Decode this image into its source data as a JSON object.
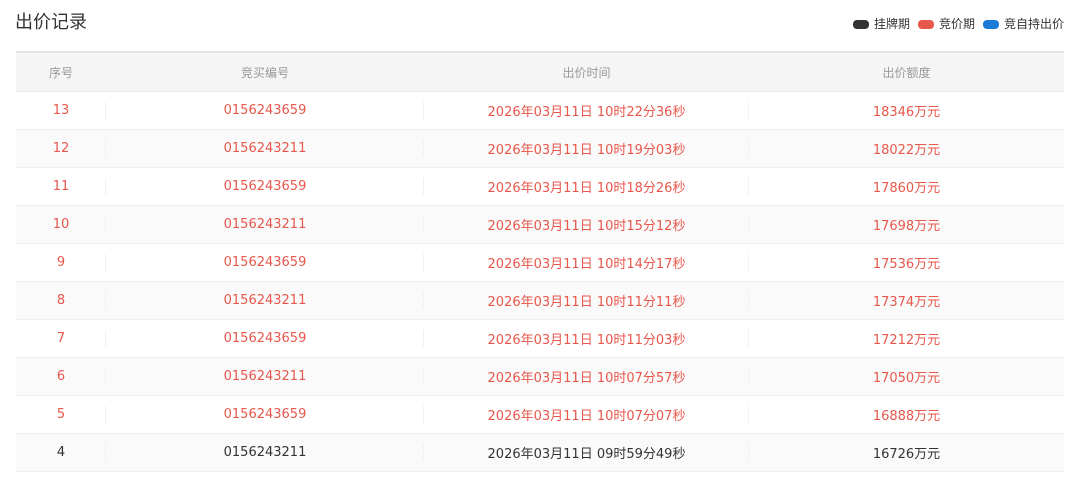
{
  "header": {
    "title": "出价记录"
  },
  "legend": [
    {
      "label": "挂牌期",
      "color": "#333333"
    },
    {
      "label": "竞价期",
      "color": "#e8574c"
    },
    {
      "label": "竞自持出价",
      "color": "#1b7bd6"
    }
  ],
  "table": {
    "columns": [
      "序号",
      "竞买编号",
      "出价时间",
      "出价额度"
    ],
    "rows": [
      {
        "seq": "13",
        "bidder": "0156243659",
        "time": "2026年03月11日 10时22分36秒",
        "amount": "18346万元",
        "status": "竞价期"
      },
      {
        "seq": "12",
        "bidder": "0156243211",
        "time": "2026年03月11日 10时19分03秒",
        "amount": "18022万元",
        "status": "竞价期"
      },
      {
        "seq": "11",
        "bidder": "0156243659",
        "time": "2026年03月11日 10时18分26秒",
        "amount": "17860万元",
        "status": "竞价期"
      },
      {
        "seq": "10",
        "bidder": "0156243211",
        "time": "2026年03月11日 10时15分12秒",
        "amount": "17698万元",
        "status": "竞价期"
      },
      {
        "seq": "9",
        "bidder": "0156243659",
        "time": "2026年03月11日 10时14分17秒",
        "amount": "17536万元",
        "status": "竞价期"
      },
      {
        "seq": "8",
        "bidder": "0156243211",
        "time": "2026年03月11日 10时11分11秒",
        "amount": "17374万元",
        "status": "竞价期"
      },
      {
        "seq": "7",
        "bidder": "0156243659",
        "time": "2026年03月11日 10时11分03秒",
        "amount": "17212万元",
        "status": "竞价期"
      },
      {
        "seq": "6",
        "bidder": "0156243211",
        "time": "2026年03月11日 10时07分57秒",
        "amount": "17050万元",
        "status": "竞价期"
      },
      {
        "seq": "5",
        "bidder": "0156243659",
        "time": "2026年03月11日 10时07分07秒",
        "amount": "16888万元",
        "status": "竞价期"
      },
      {
        "seq": "4",
        "bidder": "0156243211",
        "time": "2026年03月11日 09时59分49秒",
        "amount": "16726万元",
        "status": "挂牌期"
      }
    ]
  }
}
